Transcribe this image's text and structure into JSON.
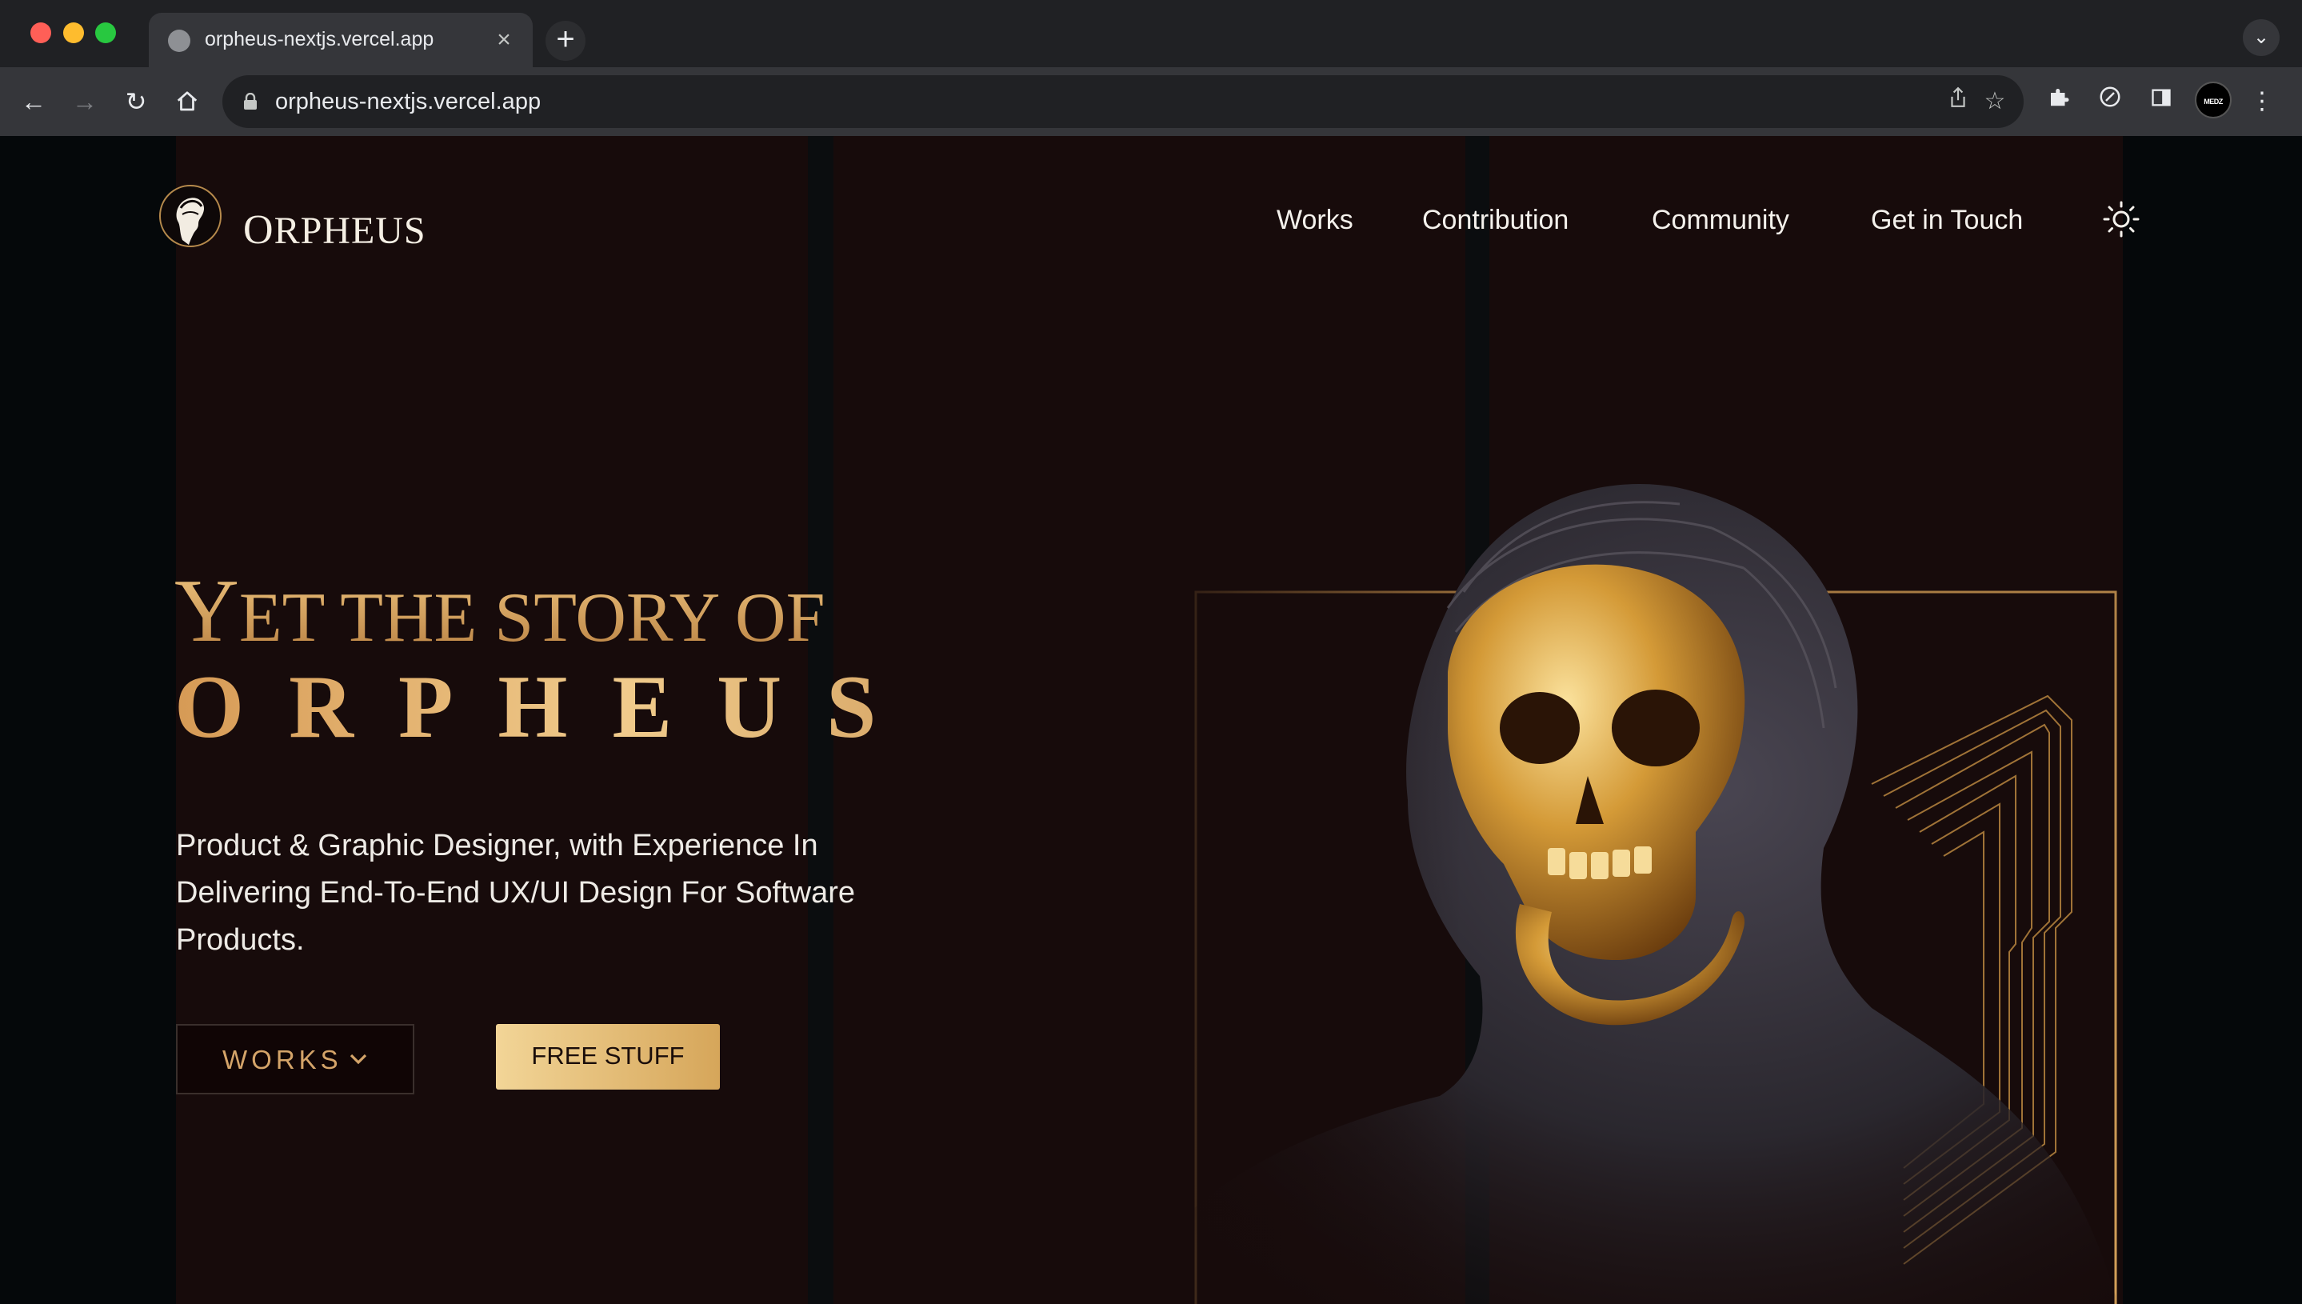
{
  "browser": {
    "tab_title": "orpheus-nextjs.vercel.app",
    "url": "orpheus-nextjs.vercel.app",
    "profile_label": "MEDZ"
  },
  "site": {
    "brand_initial": "O",
    "brand_rest": "RPHEUS",
    "nav": [
      {
        "label": "Works"
      },
      {
        "label": "Contribution"
      },
      {
        "label": "Community"
      },
      {
        "label": "Get in Touch"
      }
    ],
    "theme_toggle_icon": "sun-icon",
    "hero": {
      "line1_part1_cap": "Y",
      "line1_part1_rest": "ET THE STORY OF",
      "line2": "ORPHEUS",
      "tagline": "Product & Graphic Designer, with Experience In Delivering End-To-End UX/UI Design For Software Products.",
      "primary_button": "WORKS",
      "secondary_button": "FREE STUFF"
    },
    "colors": {
      "accent_gold": "#d7a766",
      "background": "#170b0b"
    }
  }
}
